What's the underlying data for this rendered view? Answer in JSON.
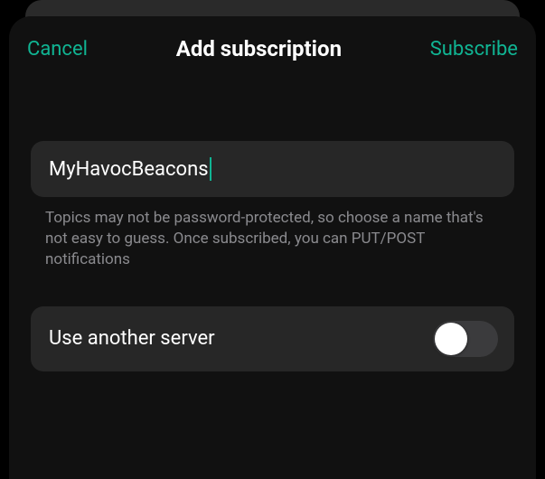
{
  "colors": {
    "accent": "#10b493"
  },
  "nav": {
    "cancel": "Cancel",
    "title": "Add subscription",
    "action": "Subscribe"
  },
  "topic": {
    "value": "MyHavocBeacons",
    "help": "Topics may not be password-protected, so choose a name that's not easy to guess. Once subscribed, you can PUT/POST notifications"
  },
  "server_row": {
    "label": "Use another server",
    "enabled": false
  }
}
